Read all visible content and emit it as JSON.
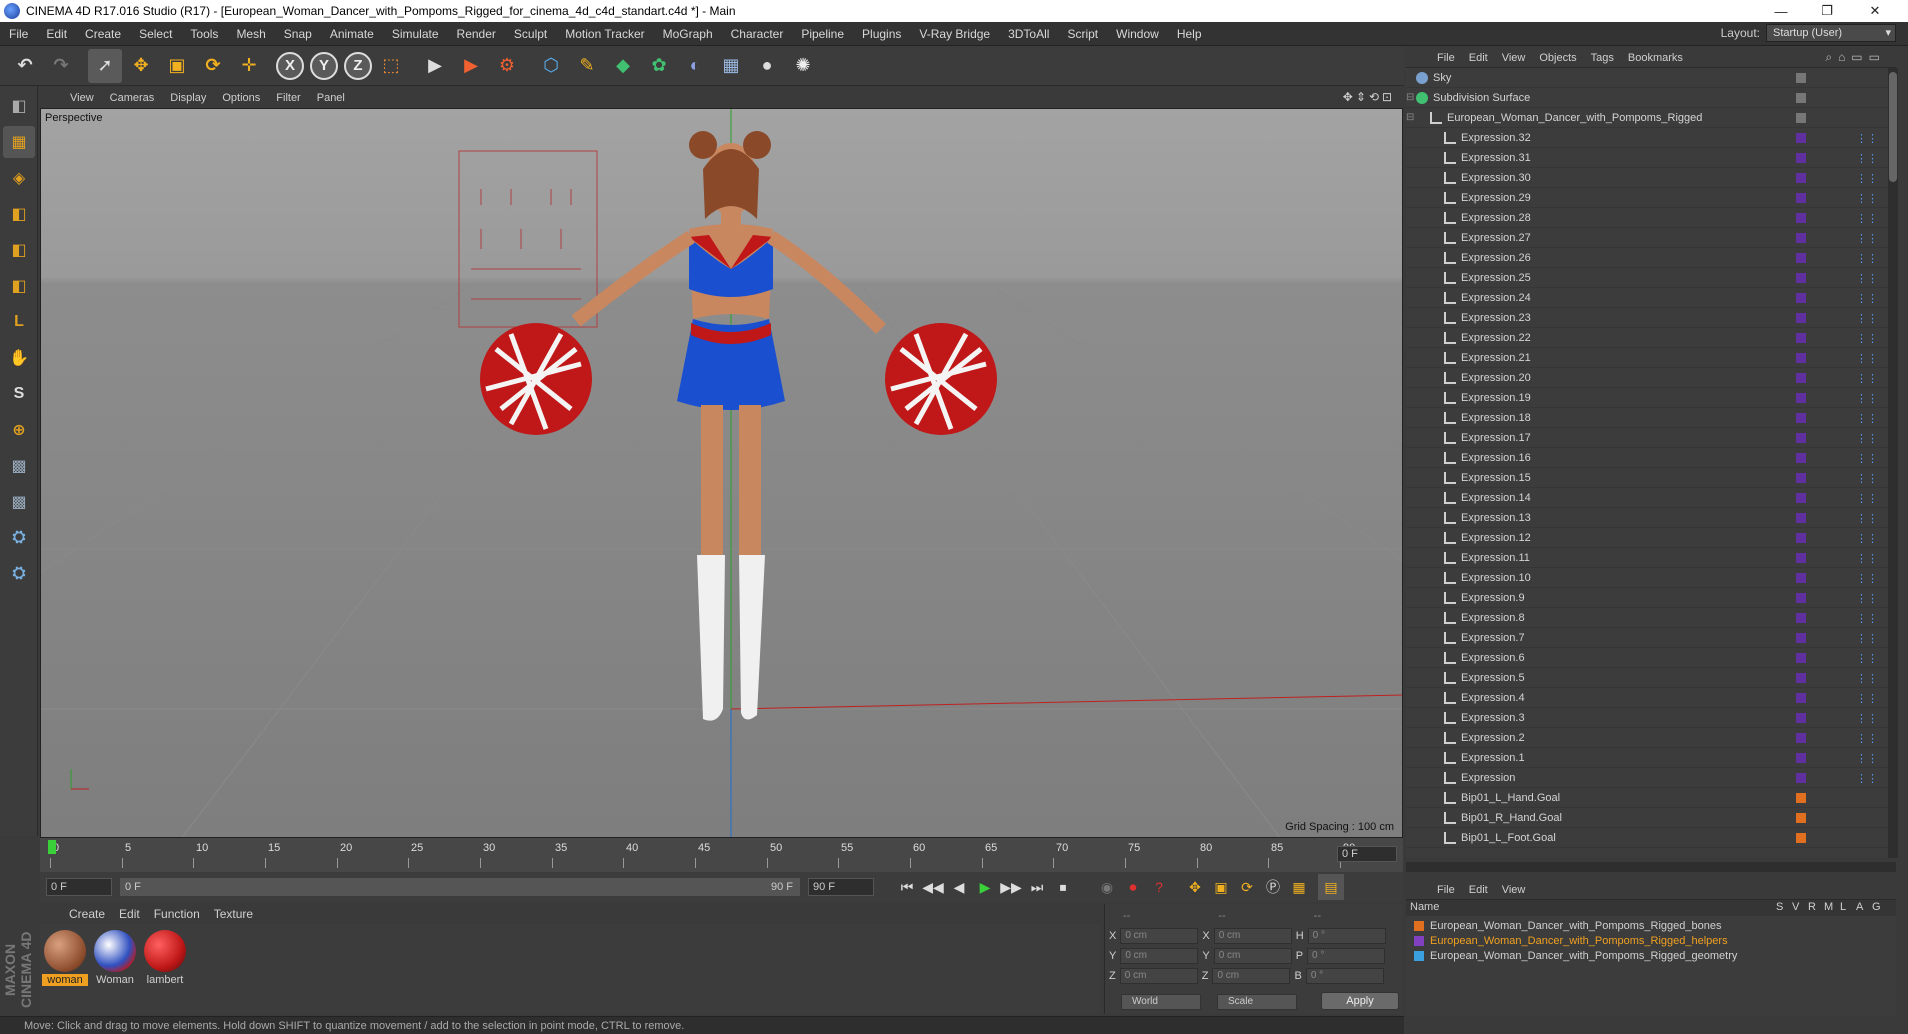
{
  "window": {
    "title": "CINEMA 4D R17.016 Studio (R17) - [European_Woman_Dancer_with_Pompoms_Rigged_for_cinema_4d_c4d_standart.c4d *] - Main",
    "minimize": "—",
    "maximize": "❐",
    "close": "✕"
  },
  "menubar": [
    "File",
    "Edit",
    "Create",
    "Select",
    "Tools",
    "Mesh",
    "Snap",
    "Animate",
    "Simulate",
    "Render",
    "Sculpt",
    "Motion Tracker",
    "MoGraph",
    "Character",
    "Pipeline",
    "Plugins",
    "V-Ray Bridge",
    "3DToAll",
    "Script",
    "Window",
    "Help"
  ],
  "layout": {
    "label": "Layout:",
    "value": "Startup (User)"
  },
  "toolbar": {
    "undo": "↶",
    "redo": "↷",
    "select": "➚",
    "move": "✥",
    "scale": "▣",
    "rotate": "⟳",
    "place": "✛",
    "x": "X",
    "y": "Y",
    "z": "Z",
    "coord": "⬚",
    "render_view": "▶",
    "render_pic": "▶",
    "render_settings": "⚙",
    "cube": "⬡",
    "pen": "✎",
    "subdiv": "◆",
    "cloner": "✿",
    "deformer": "◐",
    "floor": "▦",
    "camera": "●",
    "light": "✺"
  },
  "lefttools": [
    "◧",
    "▦",
    "◈",
    "◧",
    "◧",
    "◧",
    "L",
    "✋",
    "S",
    "⊕",
    "▩",
    "▩",
    "⛭",
    "⛭"
  ],
  "viewport": {
    "menu": [
      "View",
      "Cameras",
      "Display",
      "Options",
      "Filter",
      "Panel"
    ],
    "nav": "✥⇕⟲⊡",
    "label": "Perspective",
    "grid_spacing": "Grid Spacing : 100 cm"
  },
  "timeline": {
    "ticks": [
      "0",
      "5",
      "10",
      "15",
      "20",
      "25",
      "30",
      "35",
      "40",
      "45",
      "50",
      "55",
      "60",
      "65",
      "70",
      "75",
      "80",
      "85",
      "90"
    ],
    "frame_end": "0 F"
  },
  "playback": {
    "start": "0 F",
    "range_start": "0 F",
    "range_end": "90 F",
    "end": "90 F",
    "buttons": [
      "⏮",
      "◀◀",
      "◀",
      "▶",
      "▶▶",
      "⏭",
      "⏹"
    ]
  },
  "materials": {
    "menu": [
      "Create",
      "Edit",
      "Function",
      "Texture"
    ],
    "items": [
      {
        "name": "woman",
        "color": "#8a4a2a"
      },
      {
        "name": "Woman",
        "color": "#3050c0"
      },
      {
        "name": "lambert",
        "color": "#c01818"
      }
    ]
  },
  "coords": {
    "headers": [
      "--",
      "--",
      "--"
    ],
    "rows": [
      {
        "a": "X",
        "av": "0 cm",
        "b": "X",
        "bv": "0 cm",
        "c": "H",
        "cv": "0 °"
      },
      {
        "a": "Y",
        "av": "0 cm",
        "b": "Y",
        "bv": "0 cm",
        "c": "P",
        "cv": "0 °"
      },
      {
        "a": "Z",
        "av": "0 cm",
        "b": "Z",
        "bv": "0 cm",
        "c": "B",
        "cv": "0 °"
      }
    ],
    "world": "World",
    "scale": "Scale",
    "apply": "Apply"
  },
  "brand": "MAXON CINEMA 4D",
  "status": "Move: Click and drag to move elements. Hold down SHIFT to quantize movement / add to the selection in point mode, CTRL to remove.",
  "object_manager": {
    "menu": [
      "File",
      "Edit",
      "View",
      "Objects",
      "Tags",
      "Bookmarks"
    ],
    "items": [
      {
        "name": "Sky",
        "indent": 0,
        "kind": "sky"
      },
      {
        "name": "Subdivision Surface",
        "indent": 0,
        "kind": "subdiv"
      },
      {
        "name": "European_Woman_Dancer_with_Pompoms_Rigged",
        "indent": 1,
        "kind": "null"
      },
      {
        "name": "Expression.32",
        "indent": 2,
        "kind": "expr"
      },
      {
        "name": "Expression.31",
        "indent": 2,
        "kind": "expr"
      },
      {
        "name": "Expression.30",
        "indent": 2,
        "kind": "expr"
      },
      {
        "name": "Expression.29",
        "indent": 2,
        "kind": "expr"
      },
      {
        "name": "Expression.28",
        "indent": 2,
        "kind": "expr"
      },
      {
        "name": "Expression.27",
        "indent": 2,
        "kind": "expr"
      },
      {
        "name": "Expression.26",
        "indent": 2,
        "kind": "expr"
      },
      {
        "name": "Expression.25",
        "indent": 2,
        "kind": "expr"
      },
      {
        "name": "Expression.24",
        "indent": 2,
        "kind": "expr"
      },
      {
        "name": "Expression.23",
        "indent": 2,
        "kind": "expr"
      },
      {
        "name": "Expression.22",
        "indent": 2,
        "kind": "expr"
      },
      {
        "name": "Expression.21",
        "indent": 2,
        "kind": "expr"
      },
      {
        "name": "Expression.20",
        "indent": 2,
        "kind": "expr"
      },
      {
        "name": "Expression.19",
        "indent": 2,
        "kind": "expr"
      },
      {
        "name": "Expression.18",
        "indent": 2,
        "kind": "expr"
      },
      {
        "name": "Expression.17",
        "indent": 2,
        "kind": "expr"
      },
      {
        "name": "Expression.16",
        "indent": 2,
        "kind": "expr"
      },
      {
        "name": "Expression.15",
        "indent": 2,
        "kind": "expr"
      },
      {
        "name": "Expression.14",
        "indent": 2,
        "kind": "expr"
      },
      {
        "name": "Expression.13",
        "indent": 2,
        "kind": "expr"
      },
      {
        "name": "Expression.12",
        "indent": 2,
        "kind": "expr"
      },
      {
        "name": "Expression.11",
        "indent": 2,
        "kind": "expr"
      },
      {
        "name": "Expression.10",
        "indent": 2,
        "kind": "expr"
      },
      {
        "name": "Expression.9",
        "indent": 2,
        "kind": "expr"
      },
      {
        "name": "Expression.8",
        "indent": 2,
        "kind": "expr"
      },
      {
        "name": "Expression.7",
        "indent": 2,
        "kind": "expr"
      },
      {
        "name": "Expression.6",
        "indent": 2,
        "kind": "expr"
      },
      {
        "name": "Expression.5",
        "indent": 2,
        "kind": "expr"
      },
      {
        "name": "Expression.4",
        "indent": 2,
        "kind": "expr"
      },
      {
        "name": "Expression.3",
        "indent": 2,
        "kind": "expr"
      },
      {
        "name": "Expression.2",
        "indent": 2,
        "kind": "expr"
      },
      {
        "name": "Expression.1",
        "indent": 2,
        "kind": "expr"
      },
      {
        "name": "Expression",
        "indent": 2,
        "kind": "expr"
      },
      {
        "name": "Bip01_L_Hand.Goal",
        "indent": 2,
        "kind": "goal"
      },
      {
        "name": "Bip01_R_Hand.Goal",
        "indent": 2,
        "kind": "goal"
      },
      {
        "name": "Bip01_L_Foot.Goal",
        "indent": 2,
        "kind": "goal"
      }
    ]
  },
  "layer_manager": {
    "menu": [
      "File",
      "Edit",
      "View"
    ],
    "header": {
      "name": "Name",
      "cols": [
        "S",
        "V",
        "R",
        "M",
        "L",
        "A",
        "G"
      ]
    },
    "items": [
      {
        "name": "European_Woman_Dancer_with_Pompoms_Rigged_bones",
        "color": "#e07020",
        "text_color": "#d4d4d4"
      },
      {
        "name": "European_Woman_Dancer_with_Pompoms_Rigged_helpers",
        "color": "#8040c0",
        "text_color": "#f0a020"
      },
      {
        "name": "European_Woman_Dancer_with_Pompoms_Rigged_geometry",
        "color": "#3aa0e0",
        "text_color": "#d4d4d4"
      }
    ]
  },
  "colors": {
    "accent": "#e0a020",
    "viewport_sky": "#a3a3a3",
    "viewport_floor": "#7e7e7e"
  }
}
